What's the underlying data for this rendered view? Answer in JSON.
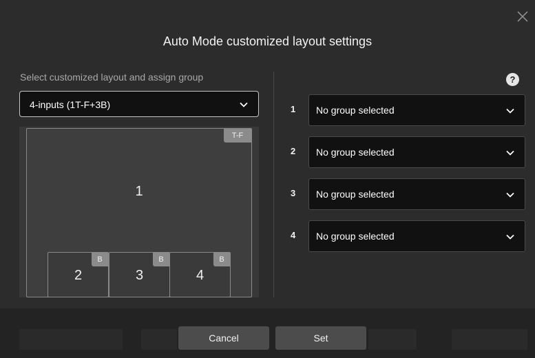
{
  "dialog": {
    "title": "Auto Mode customized layout settings"
  },
  "layout": {
    "label": "Select customized layout and assign group",
    "selected": "4-inputs (1T-F+3B)",
    "tiles": [
      {
        "number": "1",
        "tag": "T-F"
      },
      {
        "number": "2",
        "tag": "B"
      },
      {
        "number": "3",
        "tag": "B"
      },
      {
        "number": "4",
        "tag": "B"
      }
    ]
  },
  "help": {
    "glyph": "?"
  },
  "groups": [
    {
      "number": "1",
      "value": "No group selected"
    },
    {
      "number": "2",
      "value": "No group selected"
    },
    {
      "number": "3",
      "value": "No group selected"
    },
    {
      "number": "4",
      "value": "No group selected"
    }
  ],
  "buttons": {
    "cancel": "Cancel",
    "set": "Set"
  },
  "colors": {
    "panel": "#2c2c2c",
    "input_bg": "#111111",
    "button": "#4c4c4c",
    "tag": "#8b8b8b"
  },
  "icons": [
    "close-icon",
    "chevron-down-icon",
    "help-icon"
  ]
}
